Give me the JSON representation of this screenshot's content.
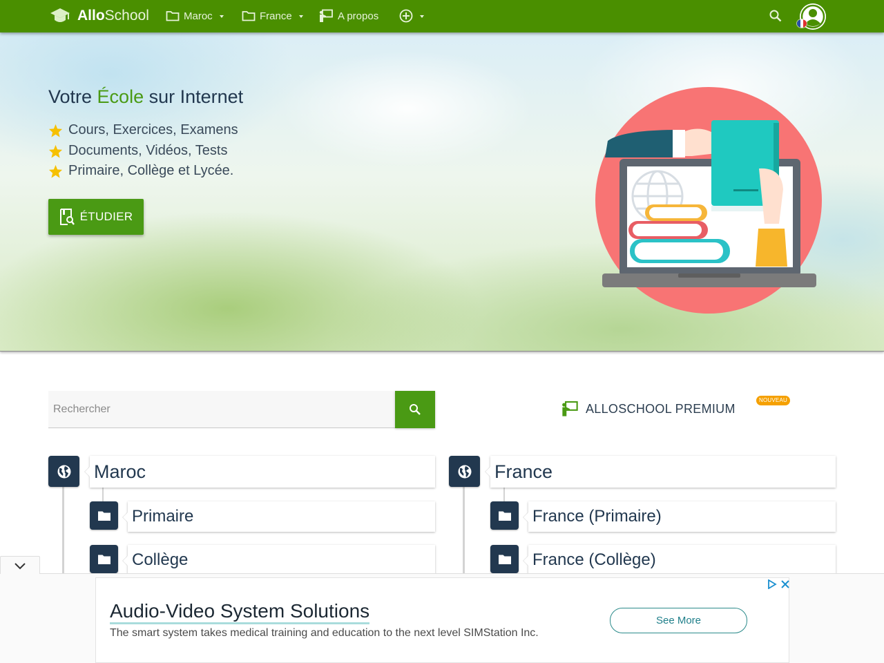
{
  "navbar": {
    "brand_bold": "Allo",
    "brand_light": "School",
    "items": [
      {
        "label": "Maroc",
        "icon": "folder-icon"
      },
      {
        "label": "France",
        "icon": "folder-icon"
      },
      {
        "label": "A propos",
        "icon": "presenter-icon"
      }
    ],
    "add_icon": "plus-circle-icon",
    "search_icon": "search-icon",
    "avatar_icon": "account-icon",
    "language_flag": "fr"
  },
  "hero": {
    "title_before": "Votre ",
    "title_highlight": "École",
    "title_after": " sur Internet",
    "features": [
      "Cours, Exercices, Examens",
      "Documents, Vidéos, Tests",
      "Primaire, Collège et Lycée."
    ],
    "cta_label": "ÉTUDIER"
  },
  "search": {
    "placeholder": "Rechercher"
  },
  "premium": {
    "label": "ALLOSCHOOL PREMIUM",
    "badge": "NOUVEAU"
  },
  "trees": [
    {
      "title": "Maroc",
      "children": [
        "Primaire",
        "Collège"
      ]
    },
    {
      "title": "France",
      "children": [
        "France (Primaire)",
        "France (Collège)"
      ]
    }
  ],
  "ad": {
    "headline": "Audio-Video System Solutions",
    "description": "The smart system takes medical training and education to the next level SIMStation Inc.",
    "button": "See More"
  },
  "colors": {
    "brand_green": "#4a8f00",
    "accent_green": "#4a9a14",
    "navy": "#22384f",
    "badge_orange": "#f5a000"
  }
}
